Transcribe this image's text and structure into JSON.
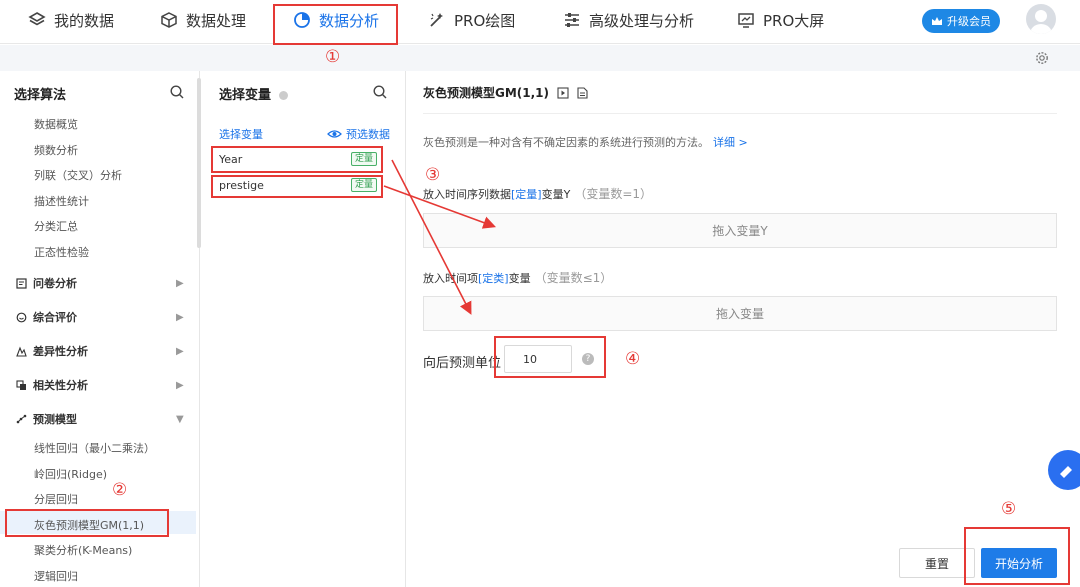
{
  "nav": {
    "items": [
      {
        "label": "我的数据",
        "icon": "layers-icon"
      },
      {
        "label": "数据处理",
        "icon": "cube-icon"
      },
      {
        "label": "数据分析",
        "icon": "pie-chart-icon"
      },
      {
        "label": "PRO绘图",
        "icon": "magic-wand-icon"
      },
      {
        "label": "高级处理与分析",
        "icon": "sliders-icon"
      },
      {
        "label": "PRO大屏",
        "icon": "monitor-chart-icon"
      }
    ],
    "upgrade_label": "升级会员",
    "accent": "#1a73e8"
  },
  "algo_panel": {
    "title": "选择算法",
    "items_top": [
      "数据概览",
      "频数分析",
      "列联（交叉）分析",
      "描述性统计",
      "分类汇总",
      "正态性检验"
    ],
    "groups": [
      {
        "label": "问卷分析",
        "icon": "survey-icon"
      },
      {
        "label": "综合评价",
        "icon": "chat-icon"
      },
      {
        "label": "差异性分析",
        "icon": "diff-chart-icon"
      },
      {
        "label": "相关性分析",
        "icon": "correlation-icon"
      },
      {
        "label": "预测模型",
        "icon": "trend-icon"
      }
    ],
    "items_bottom": [
      "线性回归（最小二乘法）",
      "岭回归(Ridge)",
      "分层回归",
      "灰色预测模型GM(1,1)",
      "聚类分析(K-Means)",
      "逻辑回归"
    ]
  },
  "var_panel": {
    "title": "选择变量",
    "select_link": "选择变量",
    "filter_link": "预选数据",
    "variables": [
      {
        "name": "Year",
        "tag": "定量"
      },
      {
        "name": "prestige",
        "tag": "定量"
      }
    ]
  },
  "main": {
    "title": "灰色预测模型GM(1,1)",
    "description": "灰色预测是一种对含有不确定因素的系统进行预测的方法。",
    "detail_link": "详细 >",
    "y_label_pre": "放入时间序列数据",
    "y_label_tag": "[定量]",
    "y_label_post": "变量Y",
    "y_count": "（变量数=1）",
    "y_drop": "拖入变量Y",
    "t_label_pre": "放入时间项",
    "t_label_tag": "[定类]",
    "t_label_post": "变量",
    "t_count": "（变量数≤1）",
    "t_drop": "拖入变量",
    "predict_label": "向后预测单位",
    "predict_value": "10",
    "reset_label": "重置",
    "start_label": "开始分析"
  },
  "annotations": [
    "①",
    "②",
    "③",
    "④",
    "⑤"
  ]
}
